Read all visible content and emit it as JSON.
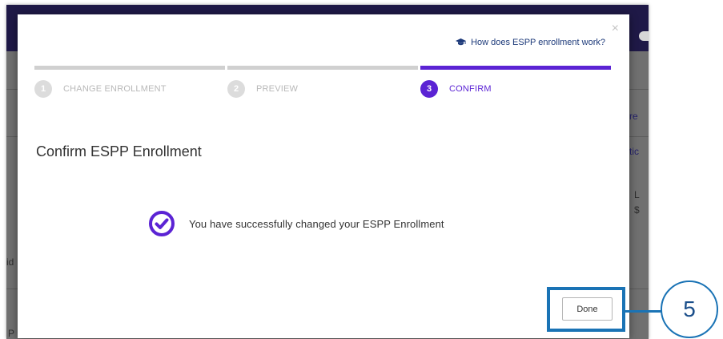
{
  "background": {
    "fragments": [
      "re",
      "tic",
      "L",
      "$",
      "id",
      "P"
    ]
  },
  "modal": {
    "close_icon": "×",
    "help_link_icon": "graduation-cap-icon",
    "help_link_label": "How does ESPP enrollment work?",
    "steps": [
      {
        "number": "1",
        "label": "CHANGE ENROLLMENT",
        "state": "done"
      },
      {
        "number": "2",
        "label": "PREVIEW",
        "state": "done"
      },
      {
        "number": "3",
        "label": "CONFIRM",
        "state": "active"
      }
    ],
    "title": "Confirm ESPP Enrollment",
    "success_icon": "check-circle-icon",
    "success_message": "You have successfully changed your ESPP Enrollment",
    "done_label": "Done"
  },
  "annotation": {
    "callout_number": "5"
  },
  "colors": {
    "accent": "#5b23d4",
    "inactive_step": "#d0d0d0",
    "annotation": "#1a73b5",
    "header": "#1f1947"
  }
}
